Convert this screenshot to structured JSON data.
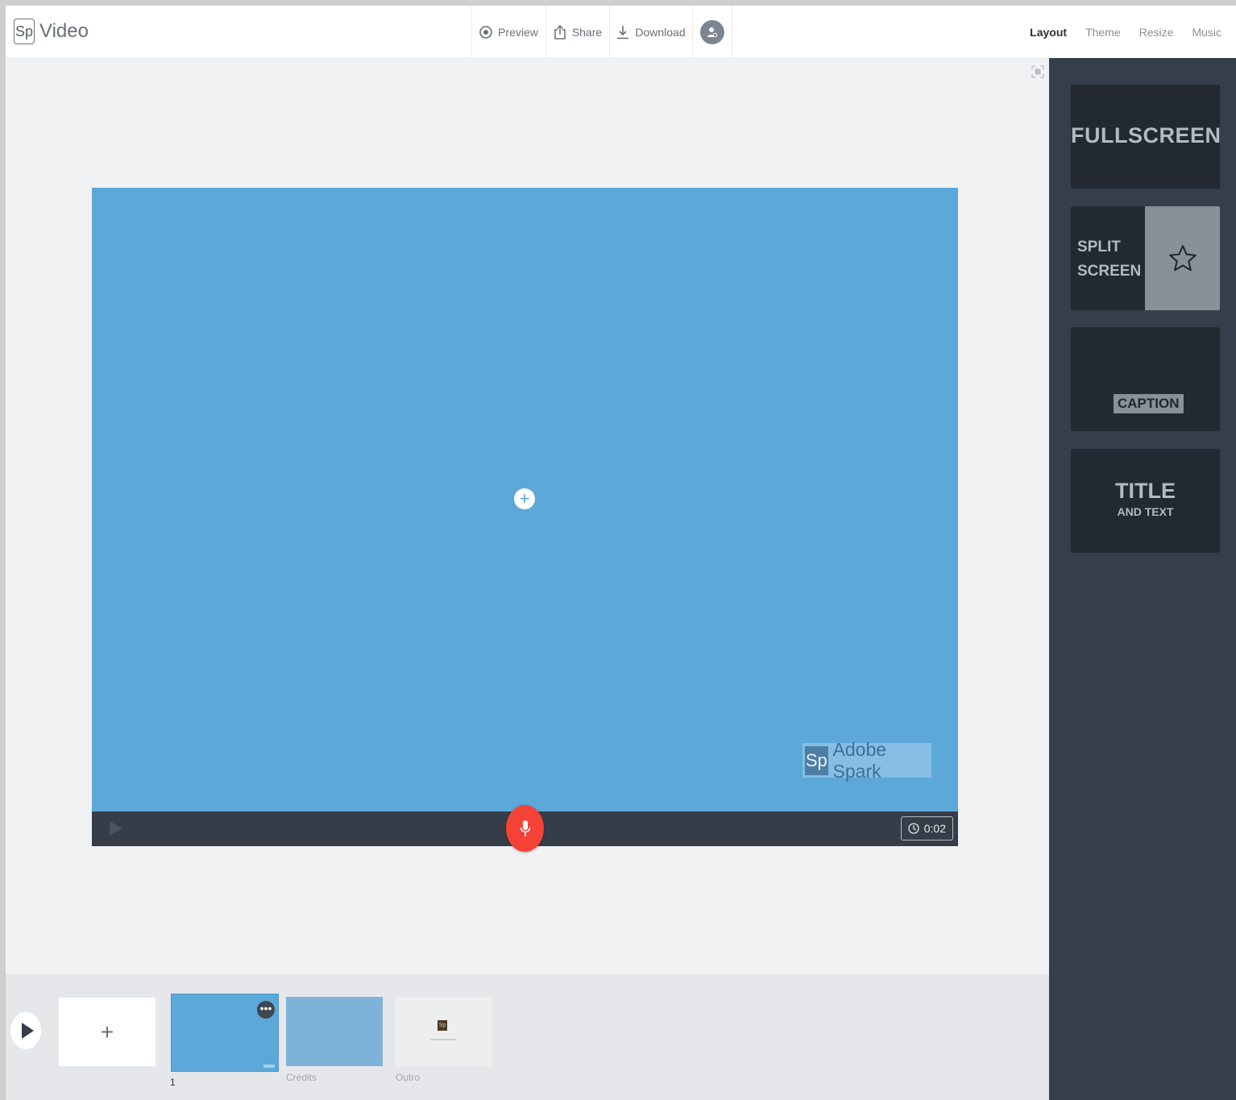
{
  "app": {
    "logo_mark": "Sp",
    "title": "Video"
  },
  "toolbar": {
    "preview_label": "Preview",
    "share_label": "Share",
    "download_label": "Download"
  },
  "tabs": [
    {
      "label": "Layout",
      "active": true
    },
    {
      "label": "Theme",
      "active": false
    },
    {
      "label": "Resize",
      "active": false
    },
    {
      "label": "Music",
      "active": false
    }
  ],
  "stage": {
    "background_color": "#5ca8d9",
    "add_media_symbol": "+",
    "watermark_mark": "Sp",
    "watermark_text": "Adobe Spark",
    "duration": "0:02"
  },
  "filmstrip": {
    "add_symbol": "+",
    "more_symbol": "•••",
    "thumbnails": [
      {
        "label": "1"
      },
      {
        "label": "Credits"
      },
      {
        "label": "Outro",
        "mini_mark": "Sp"
      }
    ]
  },
  "layouts": {
    "fullscreen": "FULLSCREEN",
    "split_line1": "SPLIT",
    "split_line2": "SCREEN",
    "caption": "CAPTION",
    "title_big": "TITLE",
    "title_small": "AND TEXT"
  },
  "colors": {
    "accent_blue": "#5ca8d9",
    "record_red": "#f44336",
    "panel_dark": "#353f4b",
    "card_dark": "#222931"
  }
}
